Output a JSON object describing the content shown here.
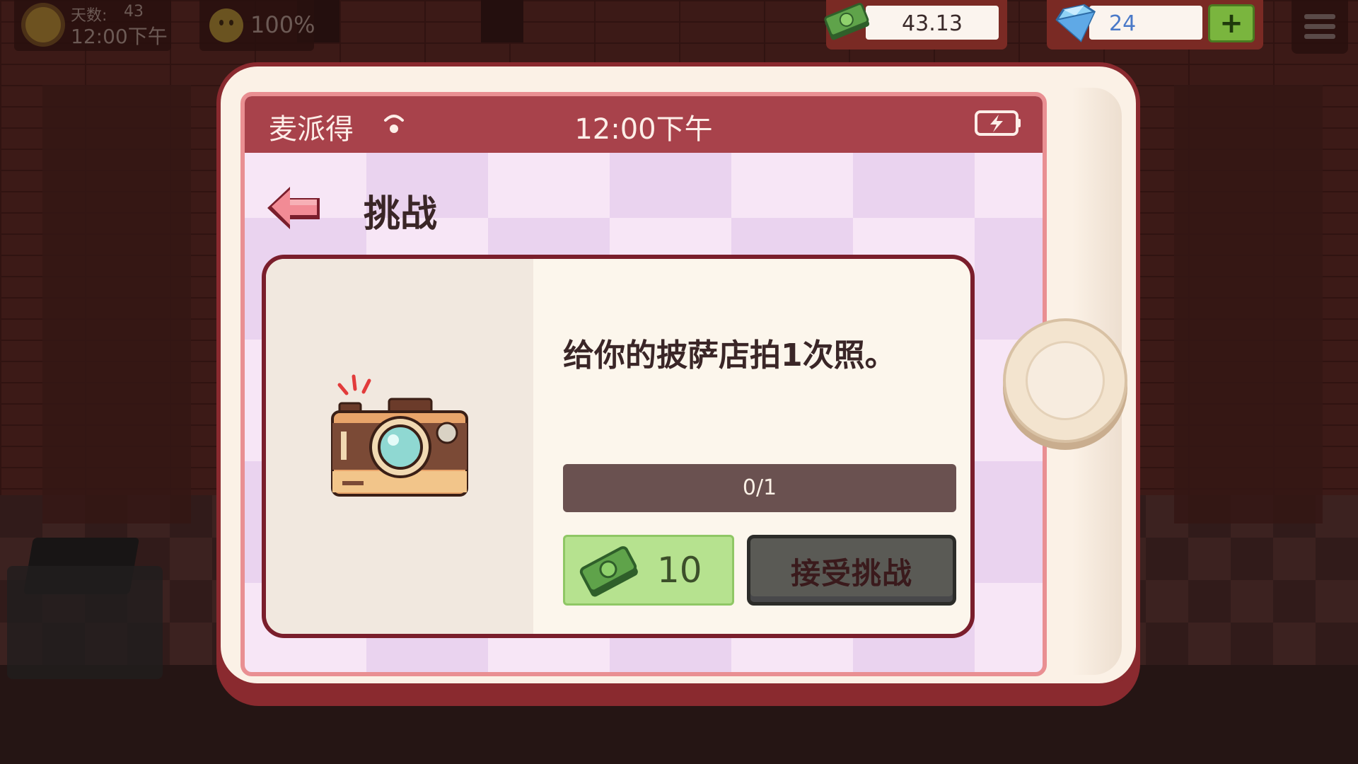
{
  "hud": {
    "day_label": "天数:",
    "day_value": "43",
    "time": "12:00下午",
    "mood": "100%",
    "money": "43.13",
    "gems": "24",
    "plus_label": "+"
  },
  "phone": {
    "carrier": "麦派得",
    "time": "12:00下午",
    "page_title": "挑战"
  },
  "challenge": {
    "description": "给你的披萨店拍1次照。",
    "progress_text": "0/1",
    "progress_fraction": 0,
    "reward": "10",
    "accept_label": "接受挑战"
  },
  "colors": {
    "status_bar": "#a8424b",
    "card_border": "#7a1e2c",
    "reward_bg": "#b6e28f",
    "accept_button": "#5a5a55",
    "progress_bg": "#6a5150"
  },
  "icons": {
    "day": "sun-icon",
    "mood": "smile-icon",
    "money": "cash-icon",
    "gems": "diamond-icon",
    "menu": "hamburger-icon",
    "back": "back-arrow-icon",
    "challenge": "camera-icon",
    "status_left": "wifi-icon",
    "status_right": "battery-icon"
  }
}
